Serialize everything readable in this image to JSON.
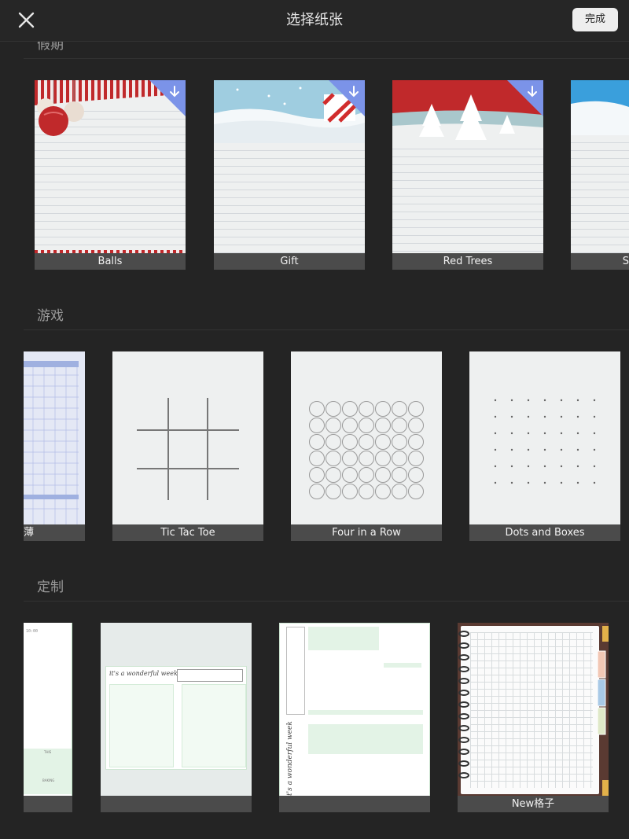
{
  "header": {
    "title": "选择纸张",
    "done_label": "完成",
    "close_icon": "close-icon"
  },
  "sections": {
    "holiday": {
      "label": "假期",
      "items": [
        {
          "label": "Balls"
        },
        {
          "label": "Gift"
        },
        {
          "label": "Red Trees"
        },
        {
          "label": "S"
        }
      ]
    },
    "games": {
      "label": "游戏",
      "items": [
        {
          "label": "薄"
        },
        {
          "label": "Tic Tac Toe"
        },
        {
          "label": "Four in a Row"
        },
        {
          "label": "Dots and Boxes"
        }
      ]
    },
    "custom": {
      "label": "定制",
      "items": [
        {
          "label": ""
        },
        {
          "label": ""
        },
        {
          "label": ""
        },
        {
          "label": "New格子"
        }
      ],
      "planner": {
        "title": "it's a wonderful week",
        "time": "10:00",
        "words": [
          "THIS",
          "BAKING"
        ]
      }
    }
  },
  "colors": {
    "background": "#242424",
    "caption": "#4b4b4b",
    "paper": "#eef0f0",
    "download_badge": "#7b93e8",
    "holiday_red": "#c0292b"
  }
}
